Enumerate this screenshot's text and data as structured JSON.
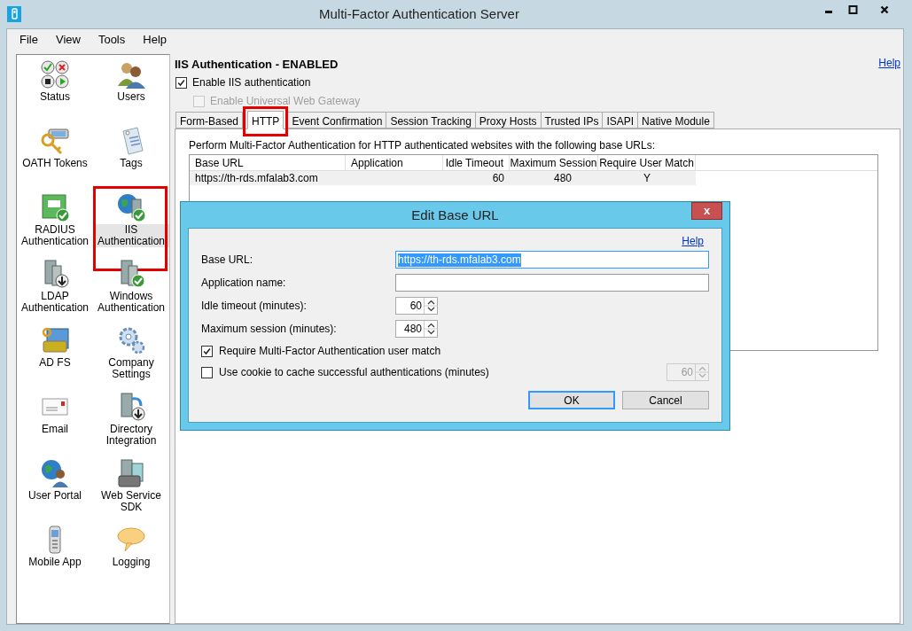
{
  "window": {
    "title": "Multi-Factor Authentication Server"
  },
  "menu": [
    "File",
    "View",
    "Tools",
    "Help"
  ],
  "sidebar": {
    "items": [
      {
        "label": "Status",
        "selected": false,
        "highlighted": false
      },
      {
        "label": "Users",
        "selected": false,
        "highlighted": false
      },
      {
        "label": "OATH Tokens",
        "selected": false,
        "highlighted": false
      },
      {
        "label": "Tags",
        "selected": false,
        "highlighted": false
      },
      {
        "label": "RADIUS Authentication",
        "selected": false,
        "highlighted": false
      },
      {
        "label": "IIS Authentication",
        "selected": true,
        "highlighted": true
      },
      {
        "label": "LDAP Authentication",
        "selected": false,
        "highlighted": false
      },
      {
        "label": "Windows Authentication",
        "selected": false,
        "highlighted": false
      },
      {
        "label": "AD FS",
        "selected": false,
        "highlighted": false
      },
      {
        "label": "Company Settings",
        "selected": false,
        "highlighted": false
      },
      {
        "label": "Email",
        "selected": false,
        "highlighted": false
      },
      {
        "label": "Directory Integration",
        "selected": false,
        "highlighted": false
      },
      {
        "label": "User Portal",
        "selected": false,
        "highlighted": false
      },
      {
        "label": "Web Service SDK",
        "selected": false,
        "highlighted": false
      },
      {
        "label": "Mobile App",
        "selected": false,
        "highlighted": false
      },
      {
        "label": "Logging",
        "selected": false,
        "highlighted": false
      }
    ]
  },
  "main": {
    "heading": "IIS Authentication - ENABLED",
    "help": "Help",
    "options": [
      {
        "label": "Enable IIS authentication",
        "checked": true,
        "disabled": false
      },
      {
        "label": "Enable Universal Web Gateway",
        "checked": false,
        "disabled": true
      }
    ],
    "tabs": [
      {
        "label": "Form-Based",
        "selected": false,
        "highlighted": false
      },
      {
        "label": "HTTP",
        "selected": true,
        "highlighted": true
      },
      {
        "label": "Event Confirmation",
        "selected": false,
        "highlighted": false
      },
      {
        "label": "Session Tracking",
        "selected": false,
        "highlighted": false
      },
      {
        "label": "Proxy Hosts",
        "selected": false,
        "highlighted": false
      },
      {
        "label": "Trusted IPs",
        "selected": false,
        "highlighted": false
      },
      {
        "label": "ISAPI",
        "selected": false,
        "highlighted": false
      },
      {
        "label": "Native Module",
        "selected": false,
        "highlighted": false
      }
    ],
    "description": "Perform Multi-Factor Authentication for HTTP authenticated websites with the following base URLs:",
    "table": {
      "columns": [
        "Base URL",
        "Application",
        "Idle Timeout",
        "Maximum Session",
        "Require User Match"
      ],
      "rows": [
        {
          "cells": [
            "https://th-rds.mfalab3.com",
            "",
            "60",
            "480",
            "Y"
          ],
          "selected": false
        }
      ]
    }
  },
  "dialog": {
    "title": "Edit Base URL",
    "close": "x",
    "help": "Help",
    "fields": [
      {
        "kind": "text",
        "label": "Base URL:",
        "value": "https://th-rds.mfalab3.com",
        "text_selected": true
      },
      {
        "kind": "text",
        "label": "Application name:"
      },
      {
        "kind": "spin",
        "label": "Idle timeout (minutes):",
        "value": "60"
      },
      {
        "kind": "spin",
        "label": "Maximum session (minutes):",
        "value": "480"
      }
    ],
    "checks": [
      {
        "label": "Require Multi-Factor Authentication user match",
        "checked": true
      },
      {
        "label": "Use cookie to cache successful authentications (minutes)",
        "checked": false,
        "spin_value": "60",
        "spin_disabled": true
      }
    ],
    "buttons": [
      {
        "label": "OK",
        "default": true
      },
      {
        "label": "Cancel",
        "default": false
      }
    ]
  }
}
